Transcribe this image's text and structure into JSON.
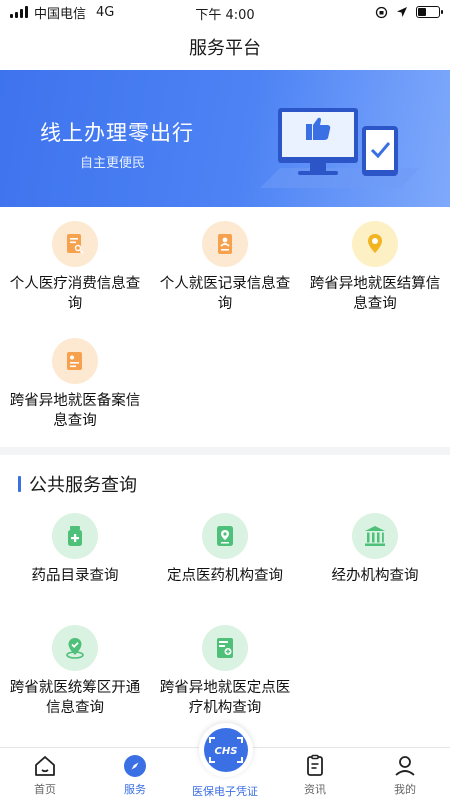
{
  "status_bar": {
    "carrier": "中国电信",
    "network": "4G",
    "time": "下午 4:00",
    "battery_level": 0.35
  },
  "nav": {
    "title": "服务平台"
  },
  "banner": {
    "title": "线上办理零出行",
    "subtitle": "自主更便民"
  },
  "personal_services": [
    {
      "label": "个人医疗消费信息查询",
      "icon": "document-search-icon"
    },
    {
      "label": "个人就医记录信息查询",
      "icon": "medical-record-icon"
    },
    {
      "label": "跨省异地就医结算信息查询",
      "icon": "location-pin-icon"
    },
    {
      "label": "跨省异地就医备案信息查询",
      "icon": "filing-document-icon"
    }
  ],
  "public_section": {
    "title": "公共服务查询"
  },
  "public_services": [
    {
      "label": "药品目录查询",
      "icon": "medicine-bottle-icon"
    },
    {
      "label": "定点医药机构查询",
      "icon": "designated-pharmacy-icon"
    },
    {
      "label": "经办机构查询",
      "icon": "institution-building-icon"
    },
    {
      "label": "跨省就医统筹区开通信息查询",
      "icon": "map-check-icon"
    },
    {
      "label": "跨省异地就医定点医疗机构查询",
      "icon": "hospital-document-icon"
    }
  ],
  "tabs": [
    {
      "label": "首页",
      "icon": "home-icon",
      "active": false
    },
    {
      "label": "服务",
      "icon": "compass-icon",
      "active": true
    },
    {
      "label": "医保电子凭证",
      "icon": "chs-icon",
      "badge_text": "CHS",
      "active": false
    },
    {
      "label": "资讯",
      "icon": "news-icon",
      "active": false
    },
    {
      "label": "我的",
      "icon": "profile-icon",
      "active": false
    }
  ],
  "colors": {
    "accent": "#3b6fe4",
    "banner_start": "#3e73ee",
    "orange_icon": "#f5a14d",
    "green_icon": "#4fc07a"
  }
}
